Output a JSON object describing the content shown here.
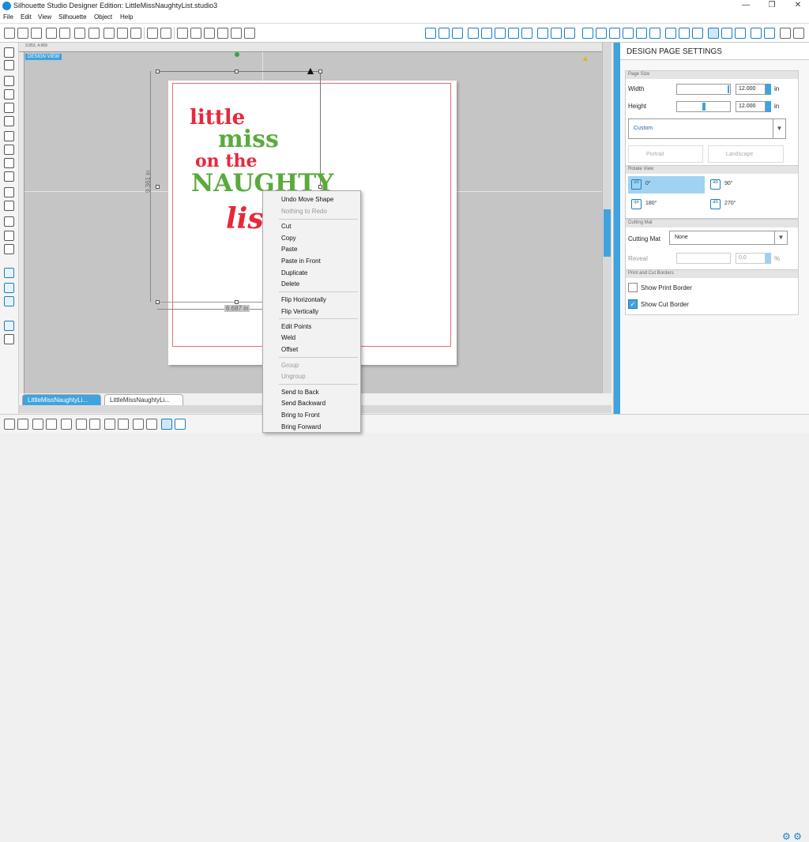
{
  "window": {
    "title": "Silhouette Studio Designer Edition: LittleMissNaughtyList.studio3",
    "minimize": "—",
    "maximize": "❐",
    "close": "✕"
  },
  "menu": [
    "File",
    "Edit",
    "View",
    "Silhouette",
    "Object",
    "Help"
  ],
  "canvas": {
    "design_view_label": "DESIGN VIEW",
    "width_dim": "6.687 in",
    "height_dim": "9.361 in",
    "ruler_left": "3.953, 4.669",
    "artwork": {
      "line1": "little",
      "line2": "miss",
      "line3": "on the",
      "line4": "NAUGHTY",
      "line5": "list"
    }
  },
  "tabs": [
    {
      "label": "LittleMissNaughtyLi...",
      "close": "✕"
    },
    {
      "label": "LittleMissNaughtyLi...",
      "close": "✕"
    }
  ],
  "context_menu": {
    "items": [
      {
        "label": "Undo Move Shape",
        "disabled": false
      },
      {
        "label": "Nothing to Redo",
        "disabled": true
      },
      {
        "label": "Cut",
        "disabled": false
      },
      {
        "label": "Copy",
        "disabled": false
      },
      {
        "label": "Paste",
        "disabled": false
      },
      {
        "label": "Paste in Front",
        "disabled": false
      },
      {
        "label": "Duplicate",
        "disabled": false
      },
      {
        "label": "Delete",
        "disabled": false
      },
      {
        "label": "Flip Horizontally",
        "disabled": false
      },
      {
        "label": "Flip Vertically",
        "disabled": false
      },
      {
        "label": "Edit Points",
        "disabled": false
      },
      {
        "label": "Weld",
        "disabled": false
      },
      {
        "label": "Offset",
        "disabled": false
      },
      {
        "label": "Group",
        "disabled": true
      },
      {
        "label": "Ungroup",
        "disabled": true
      },
      {
        "label": "Send to Back",
        "disabled": false
      },
      {
        "label": "Send Backward",
        "disabled": false
      },
      {
        "label": "Bring to Front",
        "disabled": false
      },
      {
        "label": "Bring Forward",
        "disabled": false
      }
    ]
  },
  "panel": {
    "title": "DESIGN PAGE SETTINGS",
    "page_size": {
      "section": "Page Size",
      "width_label": "Width",
      "width_value": "12.000",
      "height_label": "Height",
      "height_value": "12.000",
      "unit": "in",
      "preset": "Custom",
      "portrait": "Portrait",
      "landscape": "Landscape"
    },
    "rotate_view": {
      "section": "Rotate View",
      "options": [
        "0°",
        "90°",
        "180°",
        "270°"
      ],
      "selected": "0°"
    },
    "cutting_mat": {
      "section": "Cutting Mat",
      "label": "Cutting Mat",
      "value": "None",
      "reveal_label": "Reveal",
      "reveal_value": "0.0",
      "reveal_unit": "%"
    },
    "print_cut": {
      "section": "Print and Cut Borders",
      "show_print": "Show Print Border",
      "show_print_checked": false,
      "show_cut": "Show Cut Border",
      "show_cut_checked": true
    }
  },
  "colors": {
    "accent": "#3ea3de",
    "art_red": "#e8283a",
    "art_green": "#5aaa3c"
  }
}
